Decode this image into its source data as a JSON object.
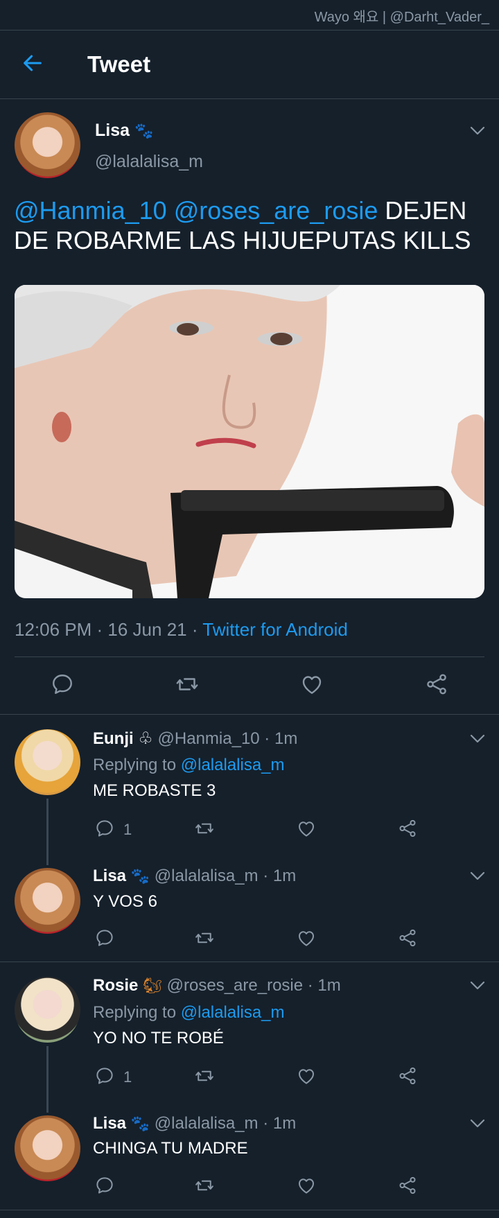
{
  "watermark": "Wayo 왜요 | @Darht_Vader_",
  "header": {
    "title": "Tweet"
  },
  "main_tweet": {
    "name": "Lisa",
    "handle": "@lalalalisa_m",
    "mention1": "@Hanmia_10",
    "mention2": "@roses_are_rosie",
    "text": "DEJEN DE ROBARME LAS HIJUEPUTAS KILLS",
    "time": "12:06 PM",
    "date": "16 Jun 21",
    "source": "Twitter for Android"
  },
  "replies": [
    {
      "name": "Eunji",
      "handle": "@Hanmia_10",
      "time": "1m",
      "replying_prefix": "Replying to ",
      "replying_to": "@lalalalisa_m",
      "text": "ME ROBASTE 3",
      "reply_count": "1"
    },
    {
      "name": "Lisa",
      "handle": "@lalalalisa_m",
      "time": "1m",
      "text": "Y VOS 6"
    },
    {
      "name": "Rosie",
      "handle": "@roses_are_rosie",
      "time": "1m",
      "replying_prefix": "Replying to ",
      "replying_to": "@lalalalisa_m",
      "text": "YO NO TE ROBÉ",
      "reply_count": "1"
    },
    {
      "name": "Lisa",
      "handle": "@lalalalisa_m",
      "time": "1m",
      "text": "CHINGA TU MADRE"
    }
  ],
  "icons": {
    "back": "arrow-left-icon",
    "reply": "comment-icon",
    "retweet": "retweet-icon",
    "like": "heart-icon",
    "share": "share-icon",
    "more": "chevron-down-icon"
  },
  "colors": {
    "background": "#15202b",
    "accent": "#1d9bf0",
    "muted": "#8b98a5",
    "divider": "#38444d"
  }
}
